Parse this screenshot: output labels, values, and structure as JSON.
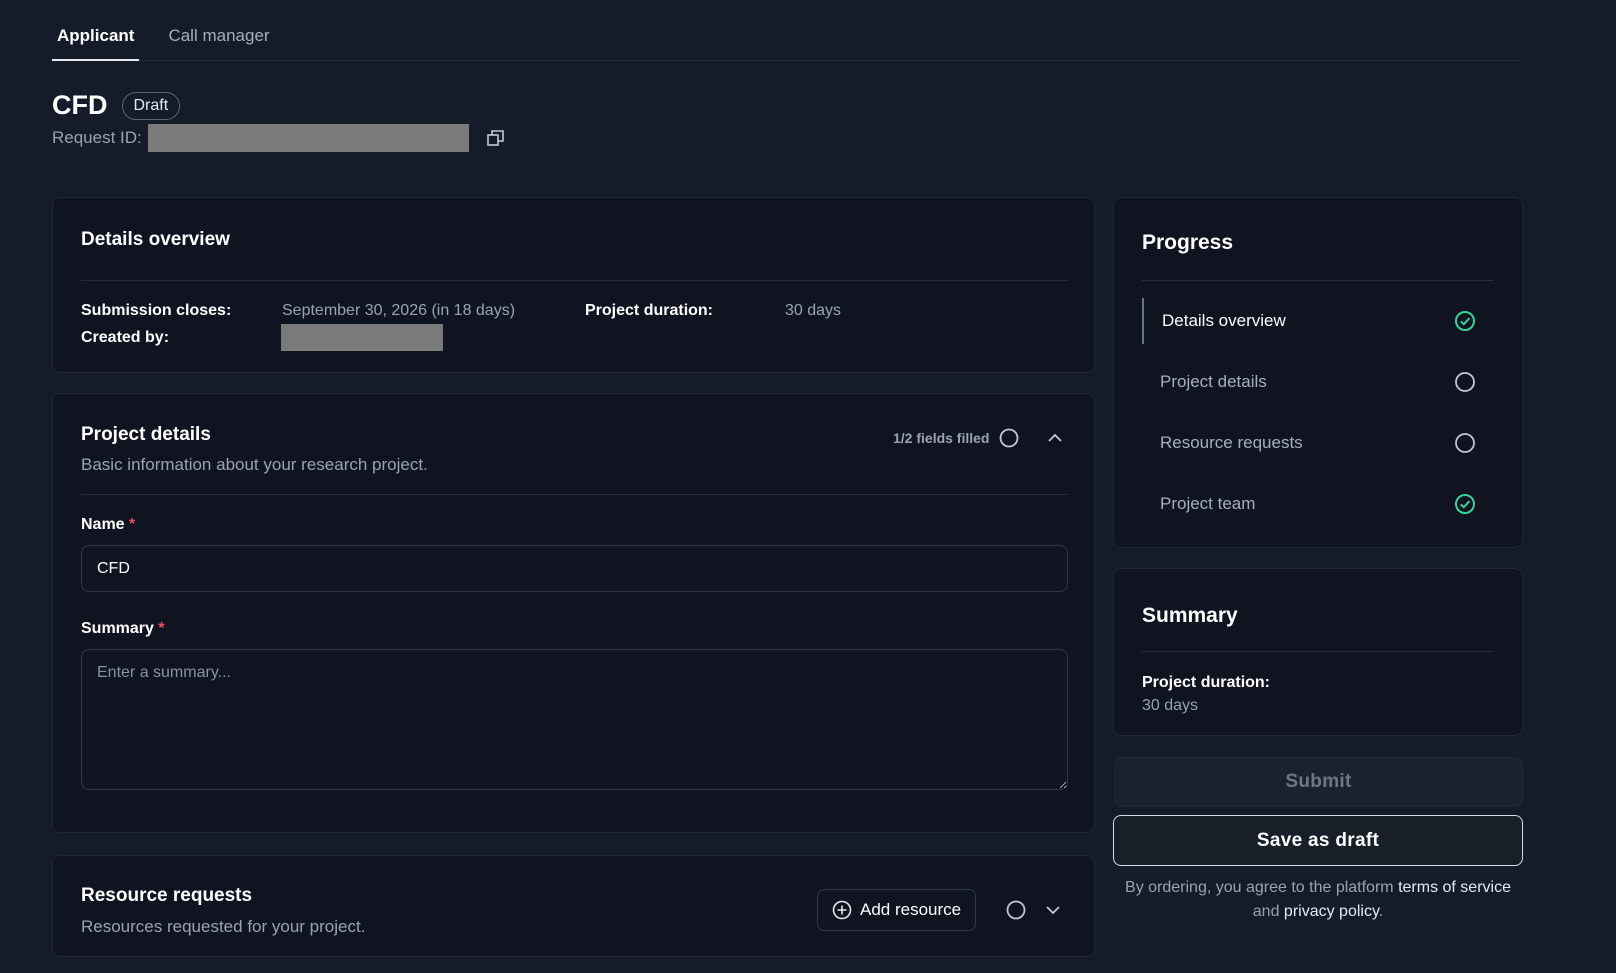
{
  "tabs": [
    {
      "label": "Applicant",
      "active": true
    },
    {
      "label": "Call manager",
      "active": false
    }
  ],
  "header": {
    "title": "CFD",
    "status_badge": "Draft",
    "request_id_label": "Request ID:"
  },
  "details_overview": {
    "title": "Details overview",
    "submission_closes_label": "Submission closes:",
    "submission_closes_value": "September 30, 2026 (in 18 days)",
    "project_duration_label": "Project duration:",
    "project_duration_value": "30 days",
    "created_by_label": "Created by:"
  },
  "project_details": {
    "title": "Project details",
    "subtitle": "Basic information about your research project.",
    "fields_filled": "1/2 fields filled",
    "name_label": "Name",
    "name_value": "CFD",
    "summary_label": "Summary",
    "summary_placeholder": "Enter a summary...",
    "required_mark": "*"
  },
  "resource_requests": {
    "title": "Resource requests",
    "subtitle": "Resources requested for your project.",
    "add_button": "Add resource"
  },
  "progress": {
    "title": "Progress",
    "steps": [
      {
        "label": "Details overview",
        "done": true,
        "active": true
      },
      {
        "label": "Project details",
        "done": false,
        "active": false
      },
      {
        "label": "Resource requests",
        "done": false,
        "active": false
      },
      {
        "label": "Project team",
        "done": true,
        "active": false
      }
    ]
  },
  "summary": {
    "title": "Summary",
    "project_duration_label": "Project duration:",
    "project_duration_value": "30 days"
  },
  "actions": {
    "submit": "Submit",
    "save_draft": "Save as draft",
    "terms_prefix": "By ordering, you agree to the platform ",
    "terms_link": "terms of service",
    "terms_and": " and ",
    "privacy_link": "privacy policy",
    "terms_suffix": "."
  },
  "colors": {
    "background": "#151b29",
    "card": "#0f1420",
    "success": "#34d399",
    "required": "#ef4b5c"
  }
}
